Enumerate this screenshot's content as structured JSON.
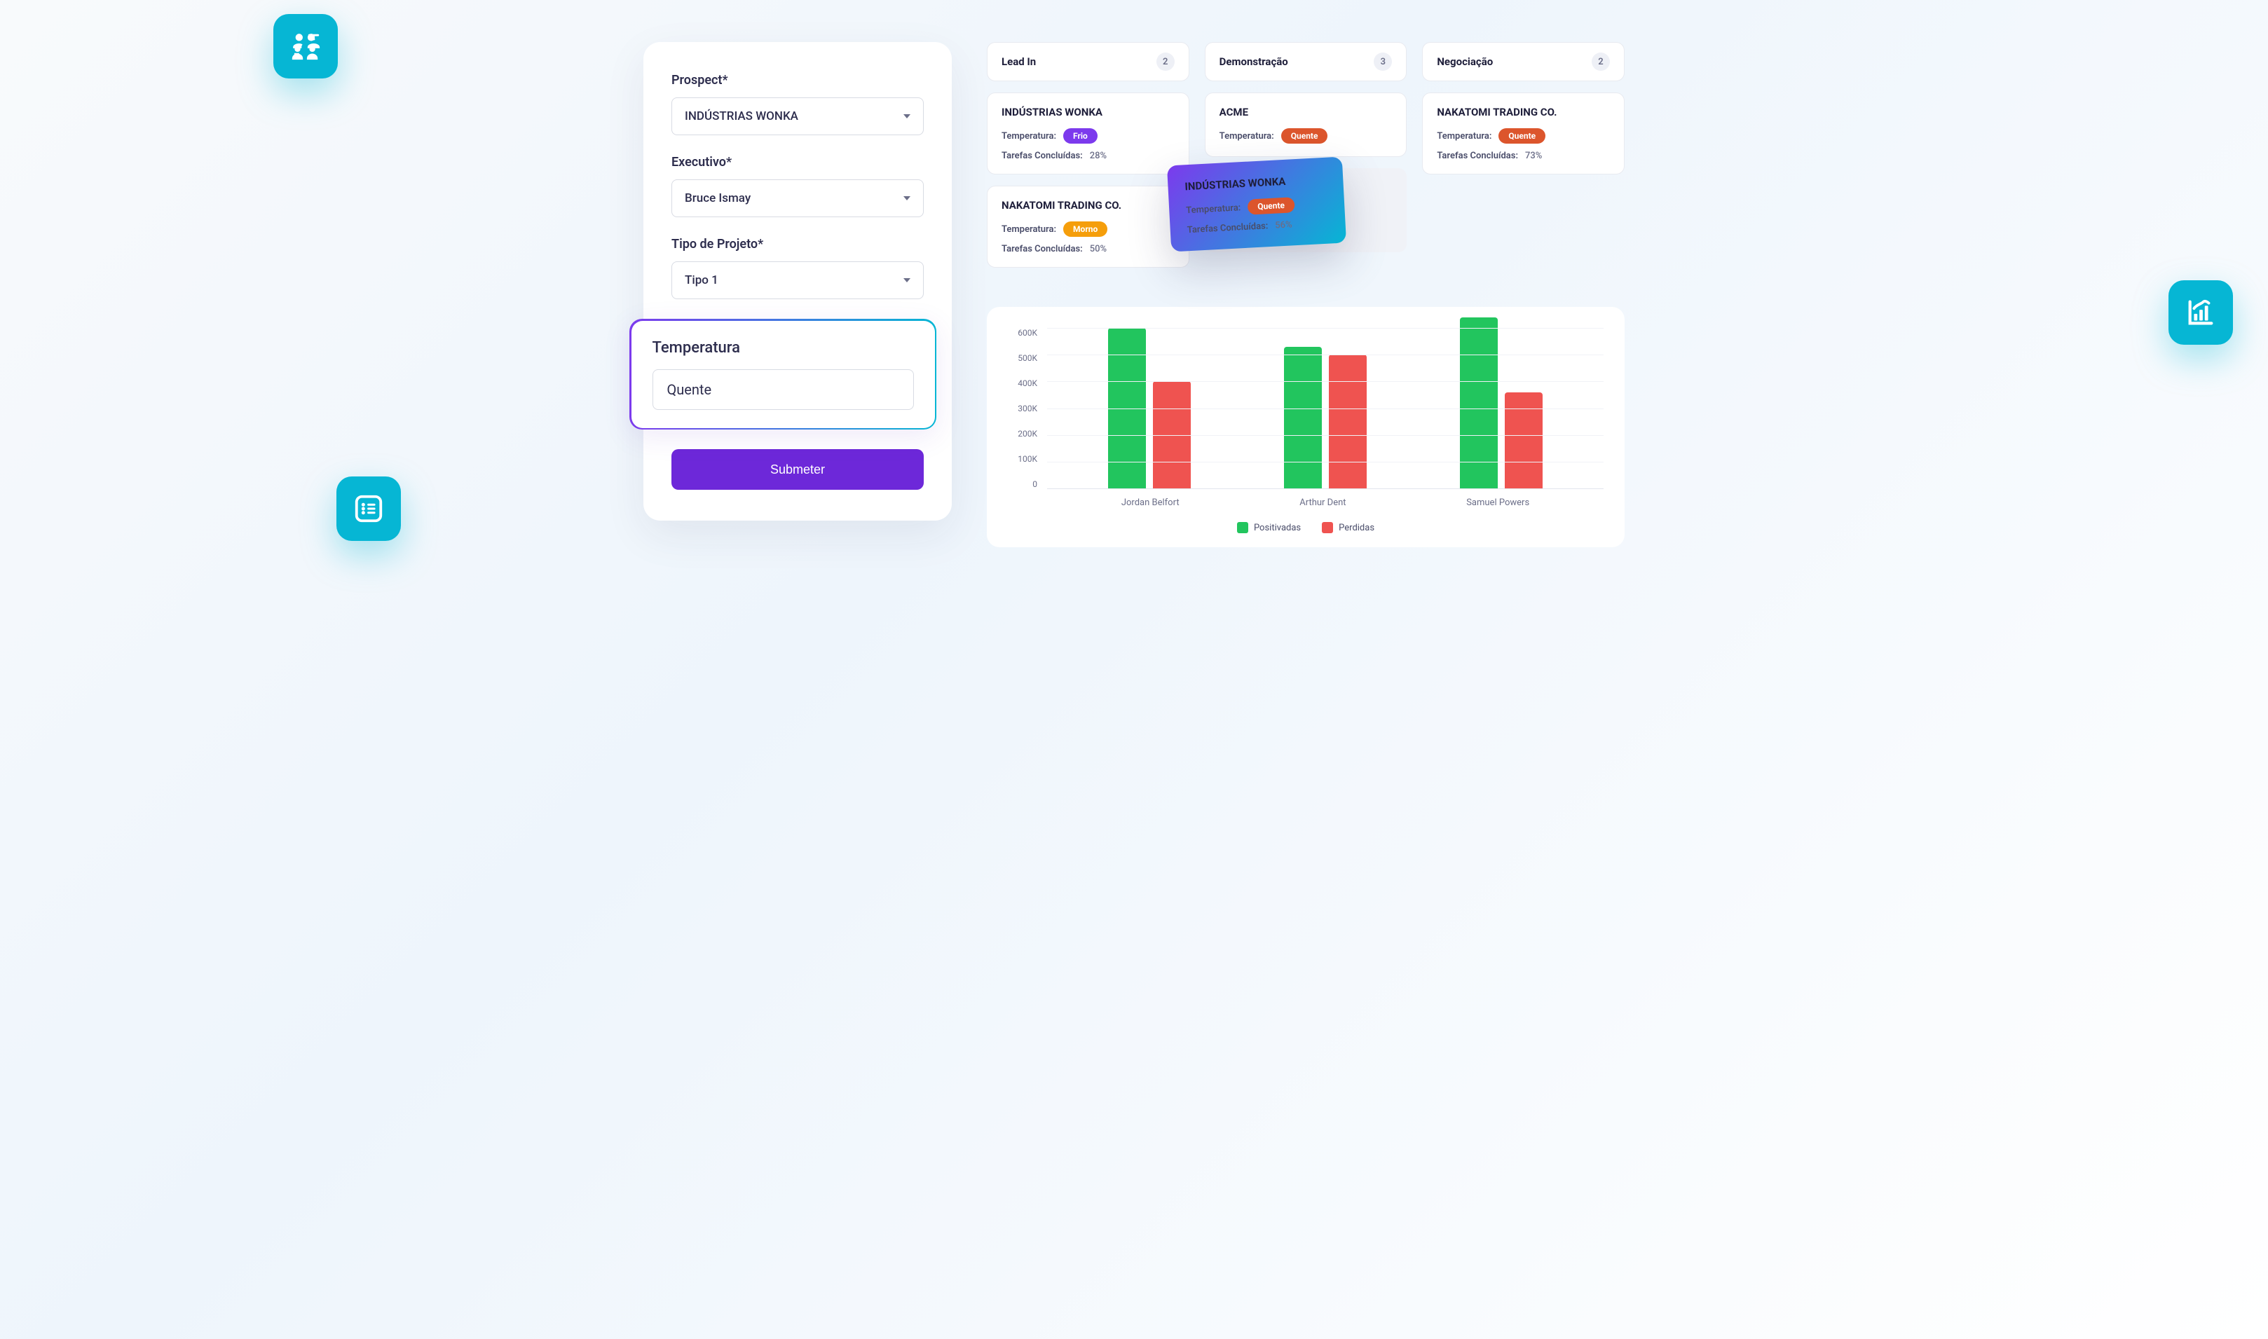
{
  "form": {
    "prospect": {
      "label": "Prospect*",
      "value": "INDÚSTRIAS WONKA"
    },
    "executive": {
      "label": "Executivo*",
      "value": "Bruce Ismay"
    },
    "project_type": {
      "label": "Tipo de Projeto*",
      "value": "Tipo 1"
    },
    "temperature": {
      "label": "Temperatura",
      "value": "Quente"
    },
    "submit": "Submeter"
  },
  "kanban": {
    "temp_label": "Temperatura:",
    "tasks_label": "Tarefas Concluídas:",
    "columns": [
      {
        "title": "Lead In",
        "count": "2",
        "cards": [
          {
            "title": "INDÚSTRIAS WONKA",
            "temp": "Frio",
            "temp_class": "badge-frio",
            "tasks": "28%"
          },
          {
            "title": "NAKATOMI TRADING CO.",
            "temp": "Morno",
            "temp_class": "badge-morno",
            "tasks": "50%"
          }
        ]
      },
      {
        "title": "Demonstração",
        "count": "3",
        "cards": [
          {
            "title": "ACME",
            "temp": "Quente",
            "temp_class": "badge-quente",
            "tasks": ""
          }
        ]
      },
      {
        "title": "Negociação",
        "count": "2",
        "cards": [
          {
            "title": "NAKATOMI TRADING CO.",
            "temp": "Quente",
            "temp_class": "badge-quente",
            "tasks": "73%"
          }
        ]
      }
    ],
    "floating_card": {
      "title": "INDÚSTRIAS WONKA",
      "temp": "Quente",
      "tasks": "56%"
    }
  },
  "chart_data": {
    "type": "bar",
    "title": "",
    "xlabel": "",
    "ylabel": "",
    "ylim": [
      0,
      600000
    ],
    "yticks": [
      "600K",
      "500K",
      "400K",
      "300K",
      "200K",
      "100K",
      "0"
    ],
    "categories": [
      "Jordan Belfort",
      "Arthur Dent",
      "Samuel Powers"
    ],
    "series": [
      {
        "name": "Positivadas",
        "color": "#22c55e",
        "values": [
          600000,
          530000,
          640000
        ]
      },
      {
        "name": "Perdidas",
        "color": "#ef5350",
        "values": [
          400000,
          500000,
          360000
        ]
      }
    ]
  }
}
